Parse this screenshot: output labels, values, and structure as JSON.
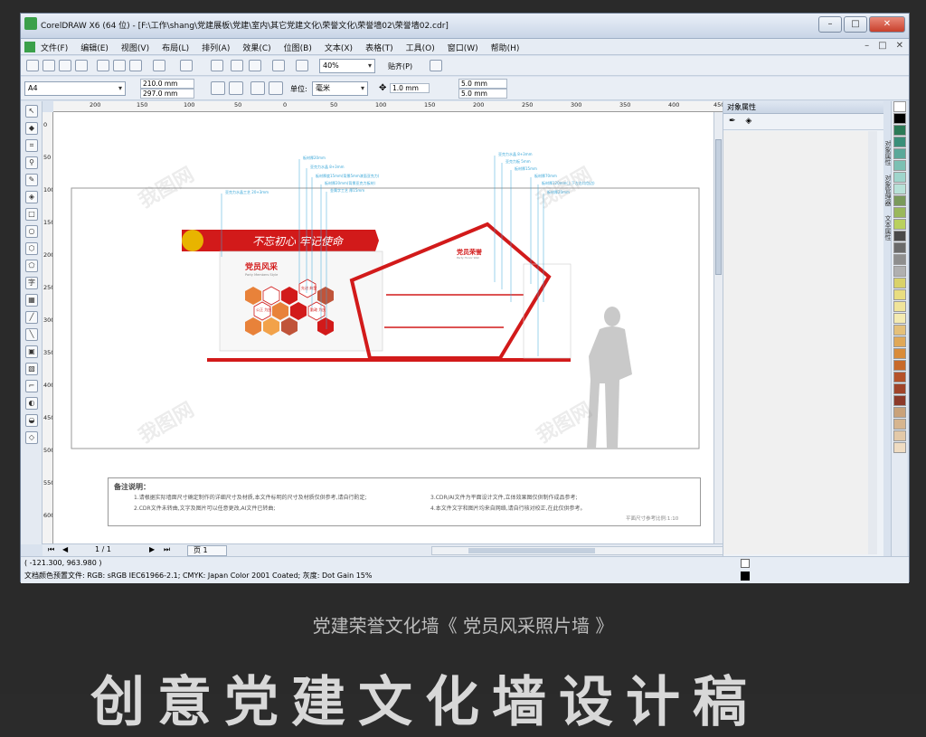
{
  "window": {
    "title": "CorelDRAW X6 (64 位) - [F:\\工作\\shang\\党建展板\\党建\\室内\\其它党建文化\\荣誉文化\\荣誉墙02\\荣誉墙02.cdr]",
    "controls": [
      "–",
      "□",
      "✕"
    ]
  },
  "menubar": {
    "items": [
      "文件(F)",
      "编辑(E)",
      "视图(V)",
      "布局(L)",
      "排列(A)",
      "效果(C)",
      "位图(B)",
      "文本(X)",
      "表格(T)",
      "工具(O)",
      "窗口(W)",
      "帮助(H)"
    ],
    "right": [
      "–",
      "□",
      "✕"
    ]
  },
  "toolbar1": {
    "zoom": "40%",
    "snap": "贴齐(P)"
  },
  "toolbar2": {
    "paper_size": "A4",
    "width": "210.0 mm",
    "height": "297.0 mm",
    "units_label": "单位:",
    "units": "毫米",
    "nudge": "1.0 mm",
    "dup_x": "5.0 mm",
    "dup_y": "5.0 mm"
  },
  "rulers": {
    "h_ticks": [
      "200",
      "150",
      "100",
      "50",
      "0",
      "50",
      "100",
      "150",
      "200",
      "250",
      "300",
      "350",
      "400",
      "450"
    ],
    "v_ticks": [
      "0",
      "50",
      "100",
      "150",
      "200",
      "250",
      "300",
      "350",
      "400",
      "450",
      "500",
      "550",
      "600"
    ]
  },
  "design": {
    "slogan": "不忘初心  牢记使命",
    "left_title": "党员风采",
    "left_sub": "Party Members Style",
    "right_title": "党员荣誉",
    "right_sub": "Party Honor Wall",
    "hex_labels": [
      "公正\n为民",
      "先进\n典型",
      "勤政\n为民"
    ],
    "callouts_left": [
      "亚克力水晶工艺 20+3mm"
    ],
    "callouts_mid": [
      "板材厚20mm",
      "亚克力水晶 8+3mm",
      "板材厚度15mm(背景5mm漆面亚克力)",
      "板材厚20mm(背景亚克力板材)",
      "金属字工艺 厚15mm"
    ],
    "callouts_right": [
      "亚克力水晶 8+3mm",
      "亚克力板 5mm",
      "板材厚15mm",
      "板材厚70mm",
      "板材厚120mm(上下左右均包边)",
      "板材厚20mm"
    ],
    "notes_title": "备注说明：",
    "notes": [
      "1.请根据实际墙面尺寸确定制作的详细尺寸及材质,本文件标明的尺寸及材质仅供参考,请自行酌定;",
      "2.CDR文件未转曲,文字及图片可以任意更改,AI文件已转曲;",
      "3.CDR/AI文件为平面设计文件,立体效果图仅供制作成品参考;",
      "4.本文件文字和图片均来自网络,请自行核对校正,在此仅供参考。"
    ],
    "scale_note": "平面尺寸参考比例:1:10"
  },
  "pagebar": {
    "page_count": "1 / 1",
    "page_tab": "页 1"
  },
  "status": {
    "coords": "( -121.300, 963.980 )",
    "profile": "文档颜色预置文件: RGB: sRGB IEC61966-2.1; CMYK: Japan Color 2001 Coated; 灰度: Dot Gain 15%"
  },
  "docker": {
    "title": "对象属性",
    "side_tabs": [
      "对象属性",
      "对象管理器",
      "文本属性"
    ]
  },
  "palette": [
    "#ffffff",
    "#000000",
    "#2b7a57",
    "#3a8f7a",
    "#5aa89a",
    "#7cc0b3",
    "#9fd5cc",
    "#b8e2d8",
    "#7a9a5c",
    "#9ab85c",
    "#b9d05e",
    "#4a4a4a",
    "#6b6b6b",
    "#8e8e8e",
    "#b0b0b0",
    "#d9d26a",
    "#e8dd80",
    "#f0e49a",
    "#f4ebb2",
    "#e4c07a",
    "#e0a858",
    "#d98c3a",
    "#c86a2a",
    "#b5522a",
    "#a0442a",
    "#8c3a2a",
    "#c9a27a",
    "#d6b58f",
    "#e3c9a8",
    "#efdcc2"
  ],
  "caption": "党建荣誉文化墙《 党员风采照片墙 》",
  "big_title": "创意党建文化墙设计稿",
  "colors": {
    "accent_red": "#d21a1a",
    "silhouette": "#c9c9c9"
  }
}
